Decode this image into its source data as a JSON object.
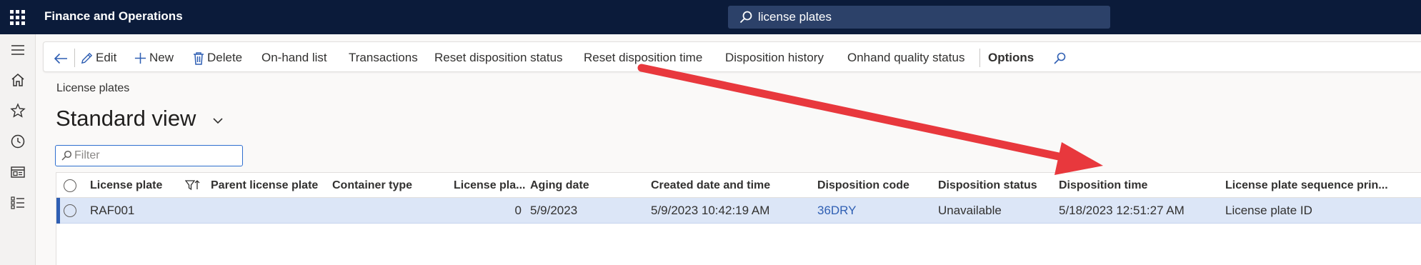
{
  "app": {
    "title": "Finance and Operations"
  },
  "search": {
    "value": "license plates"
  },
  "actions": {
    "edit": "Edit",
    "new": "New",
    "delete": "Delete",
    "onhand_list": "On-hand list",
    "transactions": "Transactions",
    "reset_disposition_status": "Reset disposition status",
    "reset_disposition_time": "Reset disposition time",
    "disposition_history": "Disposition history",
    "onhand_quality_status": "Onhand quality status",
    "options": "Options"
  },
  "breadcrumb": "License plates",
  "view": {
    "title": "Standard view"
  },
  "filter": {
    "placeholder": "Filter"
  },
  "grid": {
    "columns": {
      "license_plate": "License plate",
      "parent_license_plate": "Parent license plate",
      "container_type": "Container type",
      "license_plate_level": "License pla...",
      "aging_date": "Aging date",
      "created_date_time": "Created date and time",
      "disposition_code": "Disposition code",
      "disposition_status": "Disposition status",
      "disposition_time": "Disposition time",
      "sequence_print": "License plate sequence prin..."
    },
    "rows": [
      {
        "license_plate": "RAF001",
        "parent_license_plate": "",
        "container_type": "",
        "license_plate_level": "0",
        "aging_date": "5/9/2023",
        "created_date_time": "5/9/2023 10:42:19 AM",
        "disposition_code": "36DRY",
        "disposition_status": "Unavailable",
        "disposition_time": "5/18/2023 12:51:27 AM",
        "sequence_print": "License plate ID"
      }
    ]
  },
  "colors": {
    "topbar": "#0b1b3a",
    "accent": "#2f5fb3",
    "selected_row": "#dce6f7",
    "annotation_arrow": "#e8383d"
  },
  "icons": {
    "app_launcher": "waffle-icon",
    "search": "search-icon",
    "back": "back-arrow-icon",
    "edit": "pencil-icon",
    "new": "plus-icon",
    "delete": "trash-icon",
    "filter_sort": "filter-sort-icon"
  }
}
